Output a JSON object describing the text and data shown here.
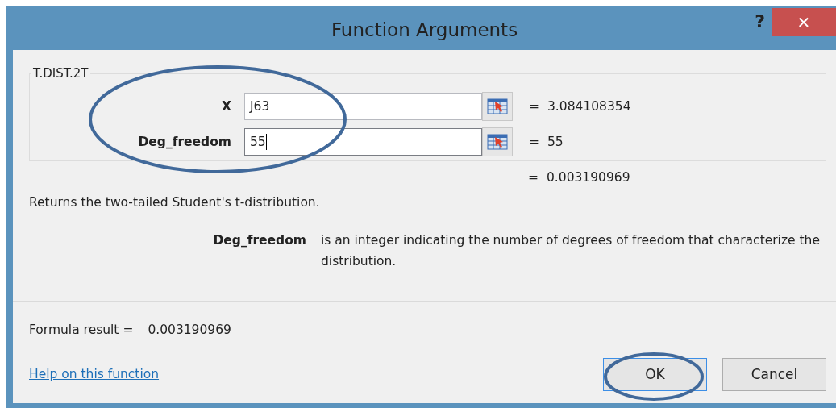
{
  "window": {
    "title": "Function Arguments",
    "help": "?",
    "close": "✕"
  },
  "function_name": "T.DIST.2T",
  "arguments": [
    {
      "label": "X",
      "value": "J63",
      "focused": false,
      "result": "3.084108354"
    },
    {
      "label": "Deg_freedom",
      "value": "55",
      "focused": true,
      "result": "55"
    }
  ],
  "equals": [
    "=",
    "=",
    "="
  ],
  "function_result": "0.003190969",
  "description": "Returns the two-tailed Student's t-distribution.",
  "argument_help": {
    "name": "Deg_freedom",
    "text": "is an integer indicating the number of degrees of freedom that characterize the distribution."
  },
  "formula_result": {
    "label": "Formula result =",
    "value": "0.003190969"
  },
  "help_link": "Help on this function",
  "buttons": [
    {
      "label": "OK",
      "selected": true
    },
    {
      "label": "Cancel",
      "selected": false
    }
  ]
}
